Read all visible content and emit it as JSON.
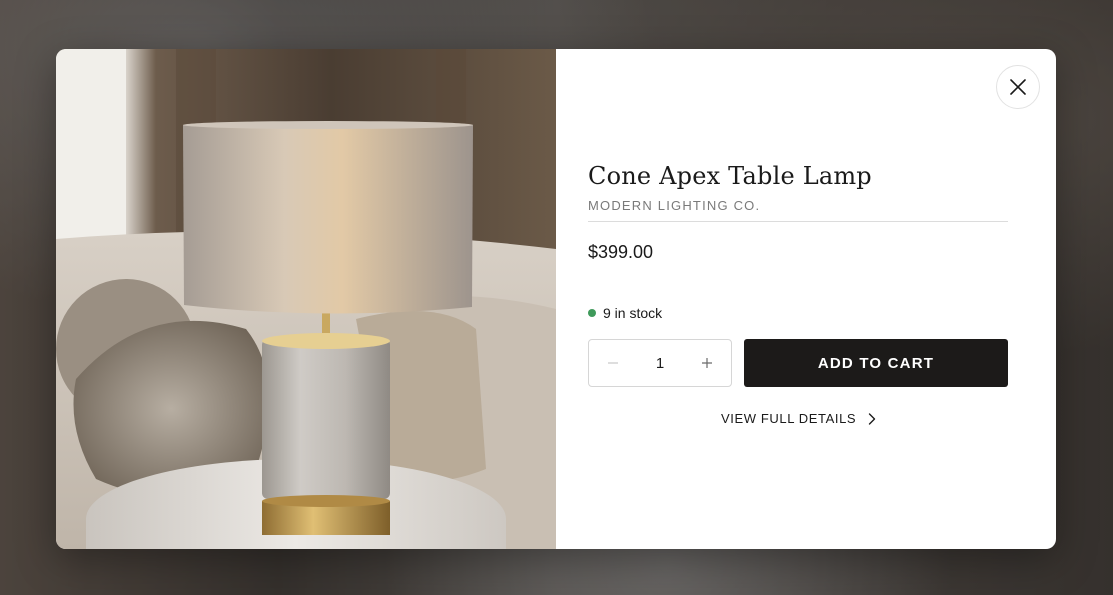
{
  "modal": {
    "close_icon": "close-icon",
    "image_alt": "Cone Apex Table Lamp"
  },
  "product": {
    "title": "Cone Apex Table Lamp",
    "vendor": "MODERN LIGHTING CO.",
    "price": "$399.00",
    "stock_text": "9 in stock",
    "stock_color": "#3f9a5b"
  },
  "quantity": {
    "value": "1",
    "decrease_icon": "minus-icon",
    "increase_icon": "plus-icon"
  },
  "actions": {
    "add_to_cart_label": "ADD TO CART",
    "view_details_label": "VIEW FULL DETAILS",
    "view_details_icon": "chevron-right-icon"
  },
  "colors": {
    "button_bg": "#1c1a19",
    "text": "#1a1a1a",
    "muted": "#7a7a7a"
  }
}
